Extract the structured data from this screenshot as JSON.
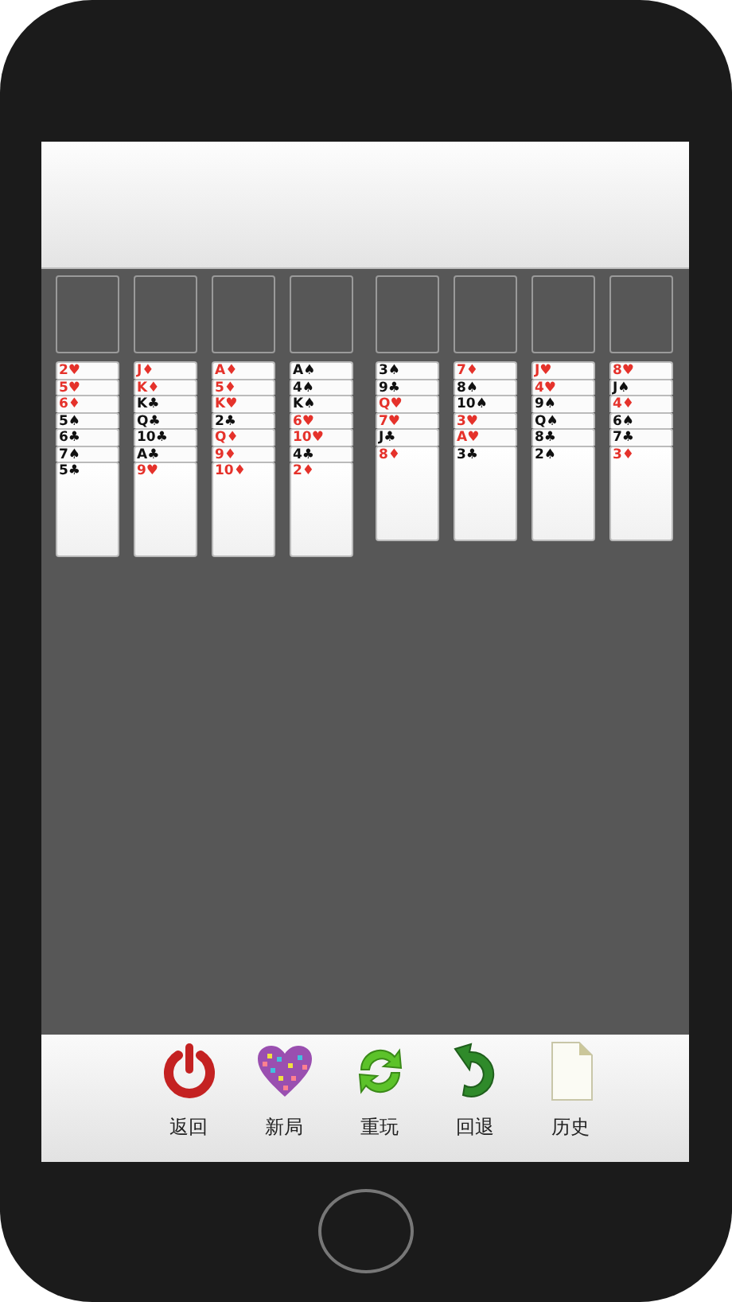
{
  "columns": [
    [
      {
        "rank": "2",
        "suit": "♥",
        "color": "#e5322b"
      },
      {
        "rank": "5",
        "suit": "♥",
        "color": "#e5322b"
      },
      {
        "rank": "6",
        "suit": "♦",
        "color": "#e5322b"
      },
      {
        "rank": "5",
        "suit": "♠",
        "color": "#111111"
      },
      {
        "rank": "6",
        "suit": "♣",
        "color": "#111111"
      },
      {
        "rank": "7",
        "suit": "♠",
        "color": "#111111"
      },
      {
        "rank": "5",
        "suit": "♣",
        "color": "#111111"
      }
    ],
    [
      {
        "rank": "J",
        "suit": "♦",
        "color": "#e5322b"
      },
      {
        "rank": "K",
        "suit": "♦",
        "color": "#e5322b"
      },
      {
        "rank": "K",
        "suit": "♣",
        "color": "#111111"
      },
      {
        "rank": "Q",
        "suit": "♣",
        "color": "#111111"
      },
      {
        "rank": "10",
        "suit": "♣",
        "color": "#111111"
      },
      {
        "rank": "A",
        "suit": "♣",
        "color": "#111111"
      },
      {
        "rank": "9",
        "suit": "♥",
        "color": "#e5322b"
      }
    ],
    [
      {
        "rank": "A",
        "suit": "♦",
        "color": "#e5322b"
      },
      {
        "rank": "5",
        "suit": "♦",
        "color": "#e5322b"
      },
      {
        "rank": "K",
        "suit": "♥",
        "color": "#e5322b"
      },
      {
        "rank": "2",
        "suit": "♣",
        "color": "#111111"
      },
      {
        "rank": "Q",
        "suit": "♦",
        "color": "#e5322b"
      },
      {
        "rank": "9",
        "suit": "♦",
        "color": "#e5322b"
      },
      {
        "rank": "10",
        "suit": "♦",
        "color": "#e5322b"
      }
    ],
    [
      {
        "rank": "A",
        "suit": "♠",
        "color": "#111111"
      },
      {
        "rank": "4",
        "suit": "♠",
        "color": "#111111"
      },
      {
        "rank": "K",
        "suit": "♠",
        "color": "#111111"
      },
      {
        "rank": "6",
        "suit": "♥",
        "color": "#e5322b"
      },
      {
        "rank": "10",
        "suit": "♥",
        "color": "#e5322b"
      },
      {
        "rank": "4",
        "suit": "♣",
        "color": "#111111"
      },
      {
        "rank": "2",
        "suit": "♦",
        "color": "#e5322b"
      }
    ],
    [
      {
        "rank": "3",
        "suit": "♠",
        "color": "#111111"
      },
      {
        "rank": "9",
        "suit": "♣",
        "color": "#111111"
      },
      {
        "rank": "Q",
        "suit": "♥",
        "color": "#e5322b"
      },
      {
        "rank": "7",
        "suit": "♥",
        "color": "#e5322b"
      },
      {
        "rank": "J",
        "suit": "♣",
        "color": "#111111"
      },
      {
        "rank": "8",
        "suit": "♦",
        "color": "#e5322b"
      }
    ],
    [
      {
        "rank": "7",
        "suit": "♦",
        "color": "#e5322b"
      },
      {
        "rank": "8",
        "suit": "♠",
        "color": "#111111"
      },
      {
        "rank": "10",
        "suit": "♠",
        "color": "#111111"
      },
      {
        "rank": "3",
        "suit": "♥",
        "color": "#e5322b"
      },
      {
        "rank": "A",
        "suit": "♥",
        "color": "#e5322b"
      },
      {
        "rank": "3",
        "suit": "♣",
        "color": "#111111"
      }
    ],
    [
      {
        "rank": "J",
        "suit": "♥",
        "color": "#e5322b"
      },
      {
        "rank": "4",
        "suit": "♥",
        "color": "#e5322b"
      },
      {
        "rank": "9",
        "suit": "♠",
        "color": "#111111"
      },
      {
        "rank": "Q",
        "suit": "♠",
        "color": "#111111"
      },
      {
        "rank": "8",
        "suit": "♣",
        "color": "#111111"
      },
      {
        "rank": "2",
        "suit": "♠",
        "color": "#111111"
      }
    ],
    [
      {
        "rank": "8",
        "suit": "♥",
        "color": "#e5322b"
      },
      {
        "rank": "J",
        "suit": "♠",
        "color": "#111111"
      },
      {
        "rank": "4",
        "suit": "♦",
        "color": "#e5322b"
      },
      {
        "rank": "6",
        "suit": "♠",
        "color": "#111111"
      },
      {
        "rank": "7",
        "suit": "♣",
        "color": "#111111"
      },
      {
        "rank": "3",
        "suit": "♦",
        "color": "#e5322b"
      }
    ]
  ],
  "toolbar": [
    {
      "label": "返回",
      "kind": "power"
    },
    {
      "label": "新局",
      "kind": "heart"
    },
    {
      "label": "重玩",
      "kind": "refresh"
    },
    {
      "label": "回退",
      "kind": "undo"
    },
    {
      "label": "历史",
      "kind": "document"
    }
  ]
}
